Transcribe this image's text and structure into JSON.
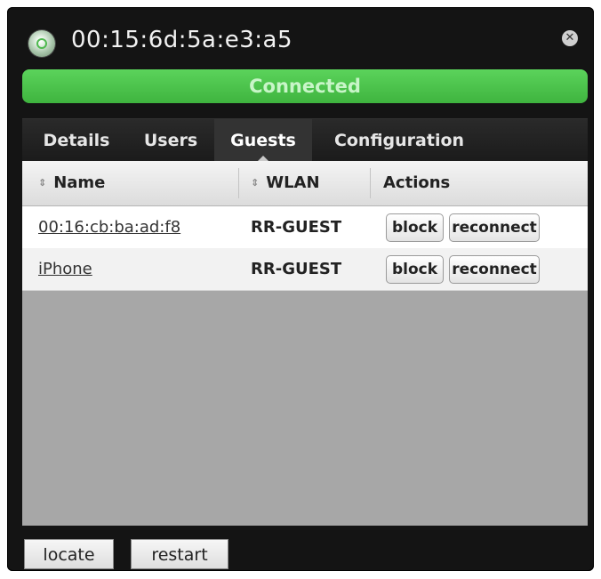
{
  "window": {
    "title": "00:15:6d:5a:e3:a5",
    "close_glyph": "✕",
    "status_text": "Connected",
    "status_color": "#4cc44c"
  },
  "tabs": [
    {
      "label": "Details",
      "active": false
    },
    {
      "label": "Users",
      "active": false
    },
    {
      "label": "Guests",
      "active": true
    },
    {
      "label": "Configuration",
      "active": false
    }
  ],
  "table": {
    "columns": [
      "Name",
      "WLAN",
      "Actions"
    ],
    "sort_glyph": "⇕",
    "rows": [
      {
        "name": "00:16:cb:ba:ad:f8",
        "wlan": "RR-GUEST",
        "action_block": "block",
        "action_reconnect": "reconnect"
      },
      {
        "name": "iPhone",
        "wlan": "RR-GUEST",
        "action_block": "block",
        "action_reconnect": "reconnect"
      }
    ]
  },
  "footer": {
    "locate_label": "locate",
    "restart_label": "restart"
  }
}
